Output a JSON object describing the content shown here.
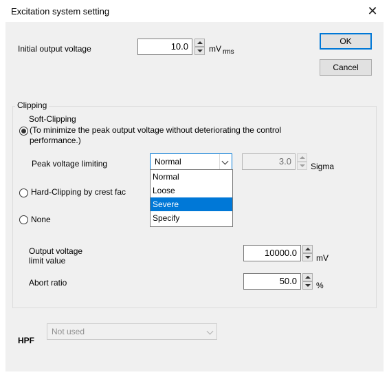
{
  "window": {
    "title": "Excitation system setting"
  },
  "initial_output": {
    "label": "Initial output voltage",
    "value": "10.0",
    "unit": "mV",
    "unit_sub": "rms"
  },
  "buttons": {
    "ok": "OK",
    "cancel": "Cancel"
  },
  "clipping": {
    "group_title": "Clipping",
    "soft": {
      "label": "Soft-Clipping",
      "description_line1": "(To minimize the peak output voltage without deteriorating the control",
      "description_line2": "performance.)",
      "selected": true
    },
    "peak": {
      "label": "Peak voltage limiting",
      "combo_value": "Normal",
      "options": [
        "Normal",
        "Loose",
        "Severe",
        "Specify"
      ],
      "highlighted_option": "Severe",
      "sigma_value": "3.0",
      "sigma_unit": "Sigma"
    },
    "hard": {
      "label": "Hard-Clipping by crest fac"
    },
    "none": {
      "label": "None"
    }
  },
  "output_limit": {
    "label_line1": "Output voltage",
    "label_line2": "limit value",
    "value": "10000.0",
    "unit": "mV"
  },
  "abort": {
    "label": "Abort ratio",
    "value": "50.0",
    "unit": "%"
  },
  "hpf": {
    "label": "HPF",
    "value": "Not used"
  }
}
